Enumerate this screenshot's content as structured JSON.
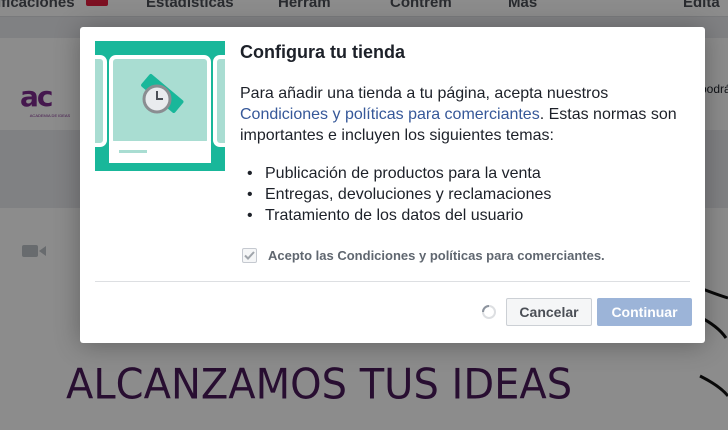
{
  "background": {
    "nav_items": [
      "ificaciones",
      "Estadísticas",
      "Herram",
      "Contrem",
      "Más",
      "Edita"
    ],
    "side_text": "podrá",
    "logo_text": "ac",
    "logo_subtext": "ACADEMIA DE IDEAS",
    "banner_text": "ALCANZAMOS TUS IDEAS"
  },
  "dialog": {
    "title": "Configura tu tienda",
    "description_prefix": "Para añadir una tienda a tu página, acepta nuestros",
    "description_link": "Condiciones y políticas para comerciantes",
    "description_suffix": ". Estas normas son importantes e incluyen los siguientes temas:",
    "bullets": [
      "Publicación de productos para la venta",
      "Entregas, devoluciones y reclamaciones",
      "Tratamiento de los datos del usuario"
    ],
    "checkbox_label": "Acepto las Condiciones y políticas para comerciantes.",
    "checkbox_checked": true,
    "cancel_label": "Cancelar",
    "continue_label": "Continuar"
  },
  "colors": {
    "illustration_teal": "#19b79a",
    "link_blue": "#365899",
    "continue_disabled": "#9cb4d8",
    "banner_purple": "#4a1a5a",
    "logo_purple": "#7e2a8e"
  }
}
